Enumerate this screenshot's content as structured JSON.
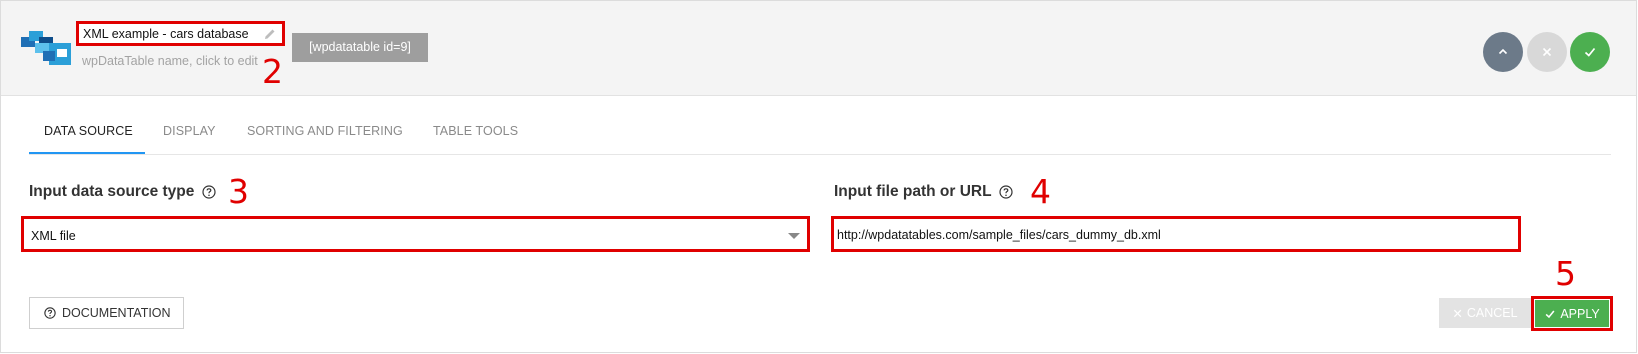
{
  "header": {
    "table_name": "XML example - cars database",
    "name_hint": "wpDataTable name, click to edit",
    "shortcode": "[wpdatatable id=9]",
    "icons": {
      "logo": "wpdatatables-logo",
      "edit": "pencil-icon",
      "collapse": "chevron-up-icon",
      "close": "close-icon",
      "save": "checkmark-icon"
    }
  },
  "annotations": {
    "name": "2",
    "source_type": "3",
    "file_path": "4",
    "apply": "5"
  },
  "tabs": [
    {
      "label": "DATA SOURCE",
      "active": true
    },
    {
      "label": "DISPLAY",
      "active": false
    },
    {
      "label": "SORTING AND FILTERING",
      "active": false
    },
    {
      "label": "TABLE TOOLS",
      "active": false
    }
  ],
  "form": {
    "source_type_label": "Input data source type",
    "source_type_value": "XML file",
    "file_path_label": "Input file path or URL",
    "file_path_value": "http://wpdatatables.com/sample_files/cars_dummy_db.xml"
  },
  "footer": {
    "documentation": "DOCUMENTATION",
    "cancel": "CANCEL",
    "apply": "APPLY"
  },
  "colors": {
    "highlight": "#e00000",
    "accent": "#2196f3",
    "success": "#4caf50",
    "shortcode_bg": "#9e9e9e",
    "collapse_bg": "#6c7a89"
  }
}
